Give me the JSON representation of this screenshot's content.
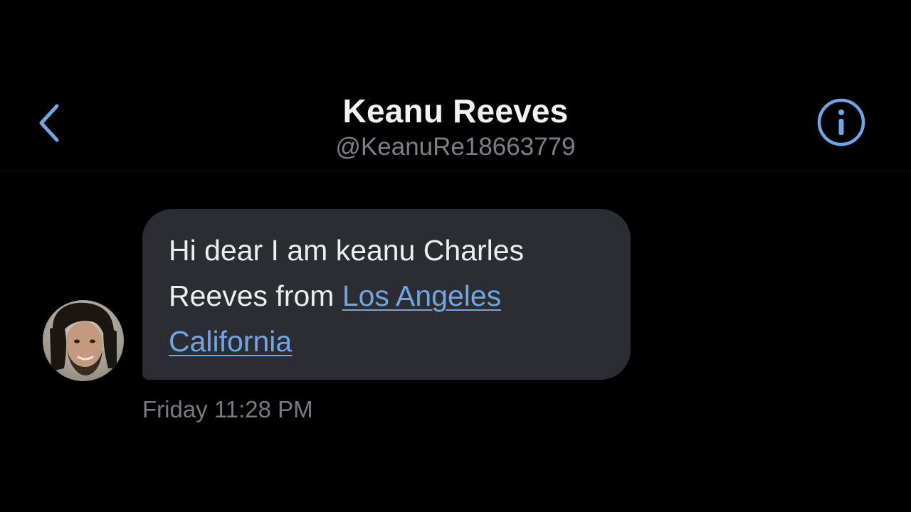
{
  "header": {
    "contact_name": "Keanu Reeves",
    "contact_handle": "@KeanuRe18663779",
    "back_icon": "chevron-left-icon",
    "info_icon": "info-circle-icon",
    "accent_color": "#6ea6e6"
  },
  "conversation": {
    "messages": [
      {
        "text_plain_1": "Hi dear I am keanu Charles Reeves from ",
        "link_1": "Los Angeles",
        "text_plain_2": " ",
        "link_2": "California",
        "bubble_color": "#2b2d33"
      }
    ],
    "timestamp": "Friday 11:28 PM"
  }
}
